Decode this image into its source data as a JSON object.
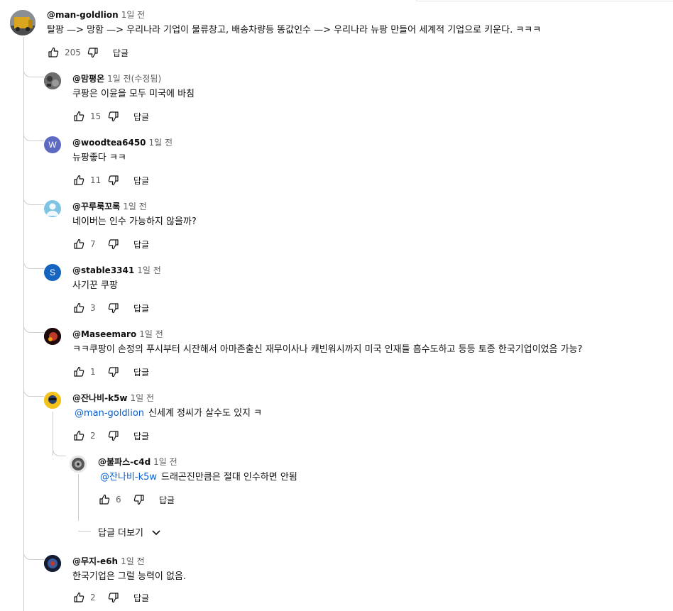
{
  "top_comment": {
    "author": "@man-goldlion",
    "time": "1일 전",
    "text": "탈팡 —> 망함 —> 우리나라 기업이 물류창고, 배송차량등 똥값인수 —> 우리나라 뉴팡 만들어 세계적 기업으로 키운다. ㅋㅋㅋ",
    "likes": "205",
    "reply_label": "답글"
  },
  "replies": [
    {
      "author": "@맘평온",
      "time": "1일 전(수정됨)",
      "text": "쿠팡은 이윤을 모두 미국에 바침",
      "likes": "15",
      "reply_label": "답글",
      "avatar_color": "#5a5a5a",
      "avatar_letter": ""
    },
    {
      "author": "@woodtea6450",
      "time": "1일 전",
      "text": "뉴팡좋다 ㅋㅋ",
      "likes": "11",
      "reply_label": "답글",
      "avatar_color": "#5c6bc0",
      "avatar_letter": "W"
    },
    {
      "author": "@꾸루룩꼬록",
      "time": "1일 전",
      "text": "네이버는 인수 가능하지 않을까?",
      "likes": "7",
      "reply_label": "답글",
      "avatar_color": "#7fc4e3",
      "avatar_letter": ""
    },
    {
      "author": "@stable3341",
      "time": "1일 전",
      "text": "사기꾼 쿠팡",
      "likes": "3",
      "reply_label": "답글",
      "avatar_color": "#1565c0",
      "avatar_letter": "S"
    },
    {
      "author": "@Maseemaro",
      "time": "1일 전",
      "text": "ㅋㅋ쿠팡이 손정의 푸시부터 시잔해서 아마존출신 재무이사나 캐빈워시까지 미국 인재들 흡수도하고 등등 토종 한국기업이었음 가능?",
      "likes": "1",
      "reply_label": "답글",
      "avatar_color": "#3a1010",
      "avatar_letter": ""
    },
    {
      "author": "@잔나비-k5w",
      "time": "1일 전",
      "mention": "@man-goldlion",
      "text": "신세계  정씨가 살수도 있지 ㅋ",
      "likes": "2",
      "reply_label": "답글",
      "avatar_color": "#f2c21b",
      "avatar_letter": ""
    },
    {
      "author": "@불파스-c4d",
      "time": "1일 전",
      "mention": "@잔나비-k5w",
      "text": "드래곤진만큼은 절대 인수하면 안됨",
      "likes": "6",
      "reply_label": "답글",
      "avatar_color": "#8a8a8a",
      "avatar_letter": ""
    },
    {
      "author": "@무지-e6h",
      "time": "1일 전",
      "text": "한국기업은 그럴 능력이 없음.",
      "likes": "2",
      "reply_label": "답글",
      "avatar_color": "#1d2a4a",
      "avatar_letter": ""
    }
  ],
  "more_replies_label": "답글 더보기",
  "icons": {
    "like": "thumb-up-icon",
    "dislike": "thumb-down-icon",
    "expand": "chevron-down-icon"
  }
}
